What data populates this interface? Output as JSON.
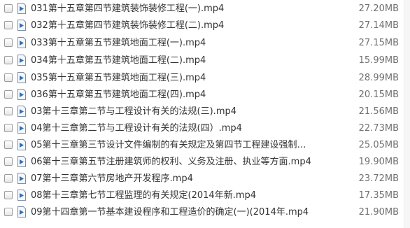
{
  "files": [
    {
      "name": "031第十五章第四节建筑装饰装修工程(一).mp4",
      "size": "27.20MB",
      "icon": "video-file-icon"
    },
    {
      "name": "032第十五章第四节建筑装饰装修工程(二).mp4",
      "size": "27.14MB",
      "icon": "video-file-icon"
    },
    {
      "name": "033第十五章第五节建筑地面工程(一).mp4",
      "size": "27.15MB",
      "icon": "video-file-icon"
    },
    {
      "name": "034第十五章第五节建筑地面工程(二).mp4",
      "size": "15.99MB",
      "icon": "video-file-icon"
    },
    {
      "name": "035第十五章第五节建筑地面工程(三).mp4",
      "size": "28.99MB",
      "icon": "video-file-icon"
    },
    {
      "name": "036第十五章第五节建筑地面工程(四).mp4",
      "size": "20.15MB",
      "icon": "video-file-icon"
    },
    {
      "name": "03第十三章第二节与工程设计有关的法规(三).mp4",
      "size": "21.56MB",
      "icon": "video-file-icon"
    },
    {
      "name": "04第十三章第二节与工程设计有关的法规(四）.mp4",
      "size": "22.73MB",
      "icon": "video-file-icon"
    },
    {
      "name": "05第十三章第三节设计文件编制的有关规定及第四节工程建设强制性...",
      "size": "25.05MB",
      "icon": "video-file-icon"
    },
    {
      "name": "06第十三章第五节注册建筑师的权利、义务及注册、执业等方面.mp4",
      "size": "19.90MB",
      "icon": "video-file-icon"
    },
    {
      "name": "07第十三章第六节房地产开发程序.mp4",
      "size": "23.72MB",
      "icon": "video-file-icon"
    },
    {
      "name": "08第十三章第七节工程监理的有关规定(2014年新.mp4",
      "size": "17.35MB",
      "icon": "video-file-icon"
    },
    {
      "name": "09第十四章第一节基本建设程序和工程造价的确定(一)(2014年.mp4",
      "size": "21.90MB",
      "icon": "video-file-icon"
    }
  ],
  "colors": {
    "text": "#333333",
    "size_text": "#707070",
    "icon_blue": "#2f6fb7"
  }
}
